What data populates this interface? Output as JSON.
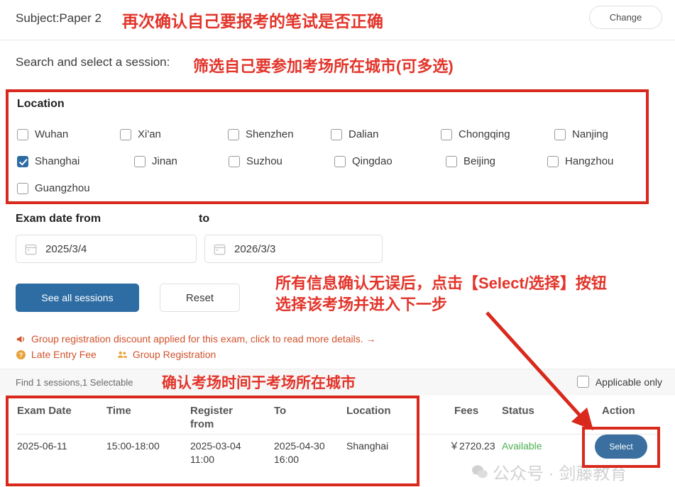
{
  "header": {
    "subject_label": "Subject:Paper 2",
    "change_button": "Change"
  },
  "search": {
    "prompt": "Search and select a session:"
  },
  "location": {
    "title": "Location",
    "cities": [
      {
        "label": "Wuhan",
        "checked": false
      },
      {
        "label": "Xi'an",
        "checked": false
      },
      {
        "label": "Shenzhen",
        "checked": false
      },
      {
        "label": "Dalian",
        "checked": false
      },
      {
        "label": "Chongqing",
        "checked": false
      },
      {
        "label": "Nanjing",
        "checked": false
      },
      {
        "label": "Shanghai",
        "checked": true
      },
      {
        "label": "Jinan",
        "checked": false
      },
      {
        "label": "Suzhou",
        "checked": false
      },
      {
        "label": "Qingdao",
        "checked": false
      },
      {
        "label": "Beijing",
        "checked": false
      },
      {
        "label": "Hangzhou",
        "checked": false
      },
      {
        "label": "Guangzhou",
        "checked": false
      }
    ]
  },
  "dates": {
    "from_label": "Exam date from",
    "to_label": "to",
    "from_value": "2025/3/4",
    "to_value": "2026/3/3"
  },
  "actions": {
    "see_all_sessions": "See all sessions",
    "reset": "Reset"
  },
  "notices": {
    "discount": "Group registration discount applied for this exam, click to read more details. →",
    "late_entry_fee": "Late Entry Fee",
    "group_registration": "Group Registration"
  },
  "results": {
    "find_text": "Find 1 sessions,1 Selectable",
    "applicable_only": "Applicable only",
    "applicable_checked": false
  },
  "table": {
    "headers": {
      "exam_date": "Exam Date",
      "time": "Time",
      "register_from": "Register from",
      "to": "To",
      "location": "Location",
      "fees": "Fees",
      "status": "Status",
      "action": "Action"
    },
    "row": {
      "exam_date": "2025-06-11",
      "time": "15:00-18:00",
      "register_from": "2025-03-04 11:00",
      "to": "2025-04-30 16:00",
      "location": "Shanghai",
      "fees": "￥2720.23",
      "status": "Available",
      "action_button": "Select"
    }
  },
  "annotations": {
    "a1": "再次确认自己要报考的笔试是否正确",
    "a2": "筛选自己要参加考场所在城市(可多选)",
    "a3_line1": "所有信息确认无误后，点击【Select/选择】按钮",
    "a3_line2": "选择该考场并进入下一步",
    "a4": "确认考场时间于考场所在城市"
  },
  "watermark": {
    "text": "公众号 · 剑藤教育"
  },
  "colors": {
    "annotation_red": "#e2342a",
    "box_red": "#d9291c",
    "primary_blue": "#2e6da4",
    "checkbox_blue": "#2d6ca2",
    "notice_orange": "#d0522c",
    "status_green": "#4caf50"
  }
}
